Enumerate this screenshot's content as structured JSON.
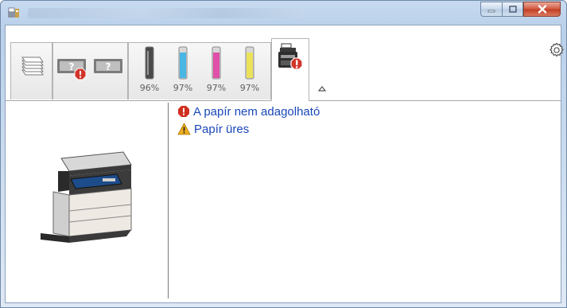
{
  "window": {
    "title_icon": "printer-app-icon",
    "caption_buttons": [
      "minimize-icon",
      "maximize-icon",
      "close-icon"
    ]
  },
  "toolbar": {
    "tabs": [
      {
        "icon": "paper-stack-icon"
      },
      {
        "icons": [
          "paper-tray-1-question-icon",
          "paper-tray-2-question-icon"
        ],
        "badge": "error"
      },
      {
        "type": "toner"
      },
      {
        "icon": "device-error-icon",
        "badge": "error",
        "active": true
      }
    ],
    "toners": [
      {
        "name": "black",
        "color": "#4a4a4a",
        "percent": "96%"
      },
      {
        "name": "cyan",
        "color": "#4ab6e3",
        "percent": "97%"
      },
      {
        "name": "magenta",
        "color": "#e04fa8",
        "percent": "97%"
      },
      {
        "name": "yellow",
        "color": "#ece25a",
        "percent": "97%"
      }
    ],
    "collapse_icon": "chevron-up-icon",
    "settings_icon": "gear-icon"
  },
  "status_messages": [
    {
      "icon": "error-icon",
      "text": "A papír nem adagolható",
      "color": "#d0301f"
    },
    {
      "icon": "warning-icon",
      "text": "Papír üres",
      "color": "#f2b01e"
    }
  ],
  "device_image": "multifunction-printer-icon"
}
